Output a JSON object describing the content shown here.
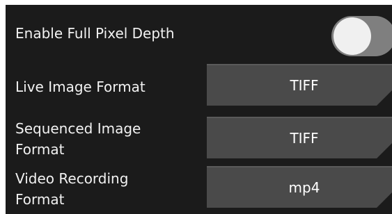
{
  "settings": {
    "full_pixel_depth": {
      "label": "Enable Full Pixel Depth",
      "enabled": false
    },
    "live_image_format": {
      "label": "Live Image Format",
      "value": "TIFF"
    },
    "sequenced_image_format": {
      "label_line1": "Sequenced Image",
      "label_line2": "Format",
      "value": "TIFF"
    },
    "video_recording_format": {
      "label_line1": "Video Recording",
      "label_line2": "Format",
      "value": "mp4"
    }
  },
  "colors": {
    "panel_background": "#1b1b1b",
    "button_background": "#4a4a4a",
    "toggle_track": "#7f7f7f",
    "toggle_knob": "#f0f0f0",
    "text": "#f2f2f2"
  },
  "icons": [
    "toggle-switch",
    "dropdown-corner-icon"
  ]
}
